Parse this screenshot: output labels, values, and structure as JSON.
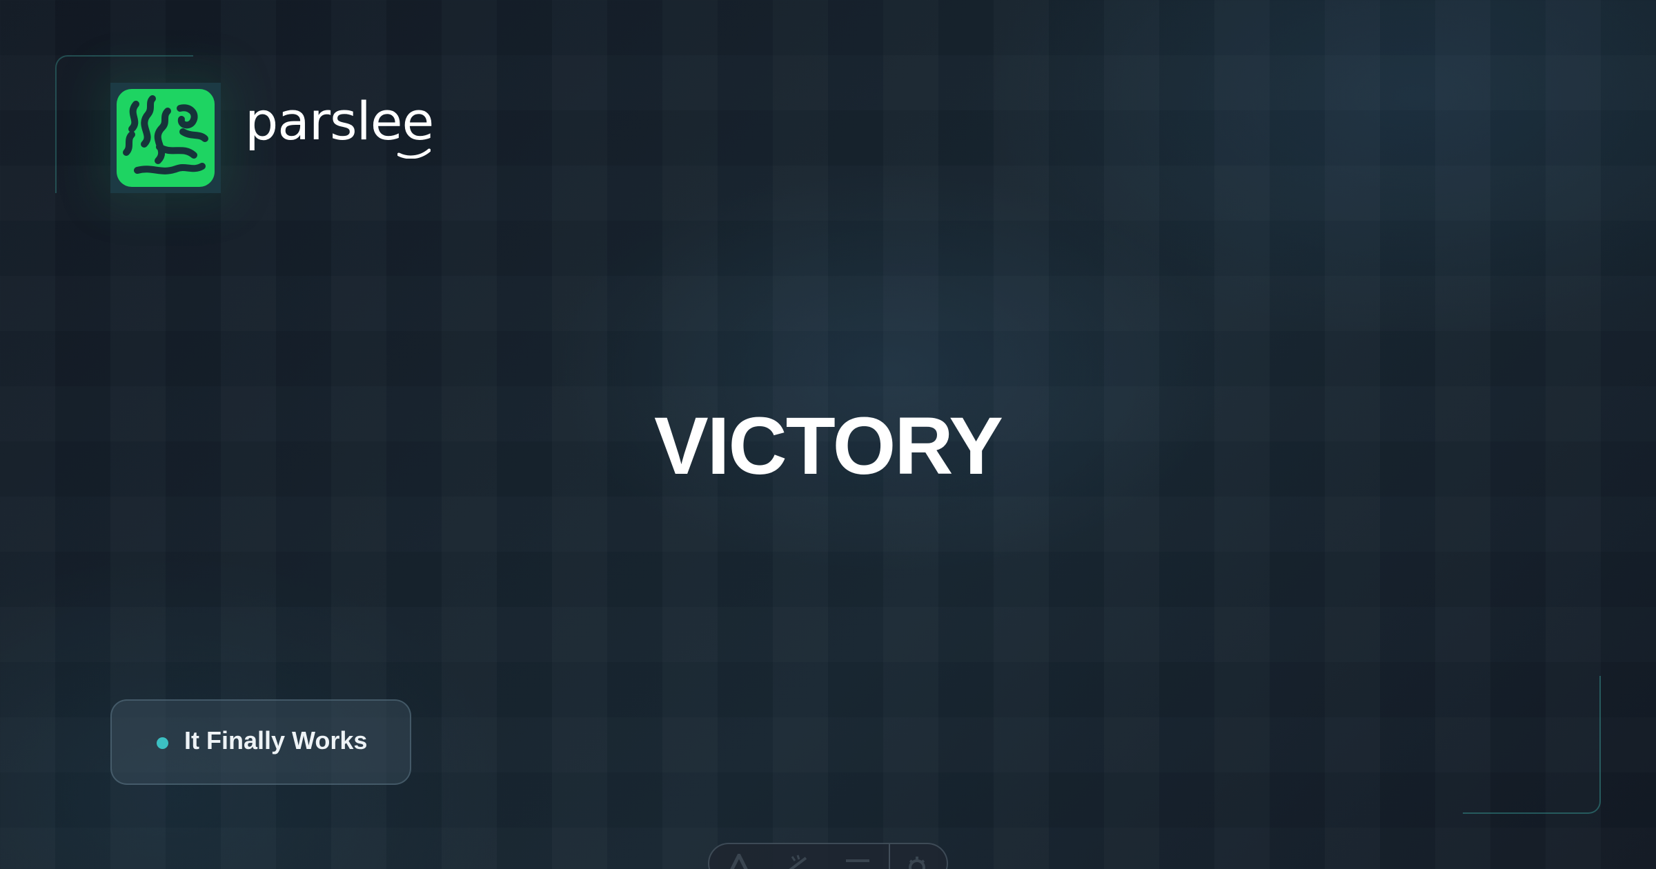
{
  "brand": {
    "name": "parslee",
    "logo_icon": "parslee-leaf-logo-icon",
    "accent_color": "#1ed462"
  },
  "slide": {
    "headline": "VICTORY"
  },
  "status_badge": {
    "label": "It Finally Works",
    "dot_color": "#3cc0c2"
  },
  "toolbar": {
    "items": [
      {
        "icon": "text-format-icon"
      },
      {
        "icon": "pen-icon"
      },
      {
        "icon": "menu-icon"
      },
      {
        "icon": "settings-icon"
      }
    ]
  },
  "colors": {
    "background": "#17222d",
    "frame_accent": "#378c87",
    "text": "#ffffff"
  }
}
